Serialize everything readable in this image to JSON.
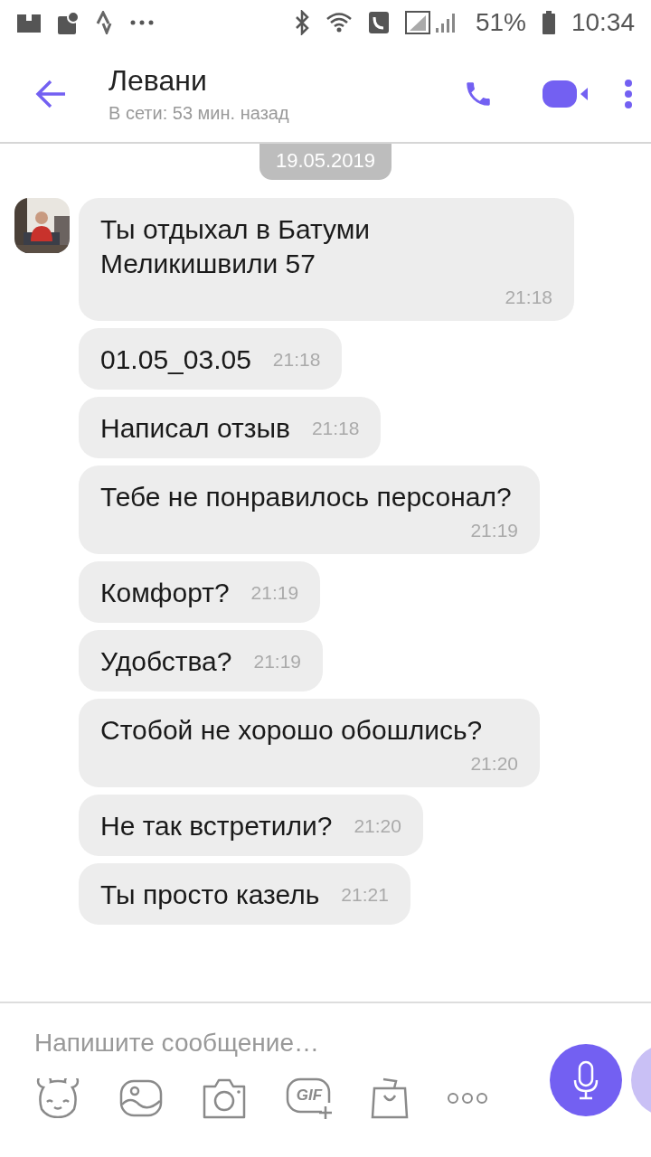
{
  "status_bar": {
    "battery": "51%",
    "time": "10:34"
  },
  "header": {
    "title": "Левани",
    "subtitle": "В сети: 53 мин. назад"
  },
  "date_chip": "19.05.2019",
  "messages": [
    {
      "text": "Ты отдыхал в Батуми Меликишвили 57",
      "time": "21:18",
      "kind": "block",
      "avatar": true
    },
    {
      "text": "01.05_03.05",
      "time": "21:18",
      "kind": "inline",
      "avatar": false
    },
    {
      "text": "Написал отзыв",
      "time": "21:18",
      "kind": "inline",
      "avatar": false
    },
    {
      "text": "Тебе не понравилось персонал?",
      "time": "21:19",
      "kind": "block",
      "avatar": false
    },
    {
      "text": "Комфорт?",
      "time": "21:19",
      "kind": "inline",
      "avatar": false
    },
    {
      "text": "Удобства?",
      "time": "21:19",
      "kind": "inline",
      "avatar": false
    },
    {
      "text": "Стобой не хорошо обошлись?",
      "time": "21:20",
      "kind": "block",
      "avatar": false
    },
    {
      "text": "Не так встретили?",
      "time": "21:20",
      "kind": "inline",
      "avatar": false
    },
    {
      "text": "Ты просто казель",
      "time": "21:21",
      "kind": "inline",
      "avatar": false
    }
  ],
  "composer": {
    "placeholder": "Напишите сообщение…",
    "gif_label": "GIF"
  }
}
